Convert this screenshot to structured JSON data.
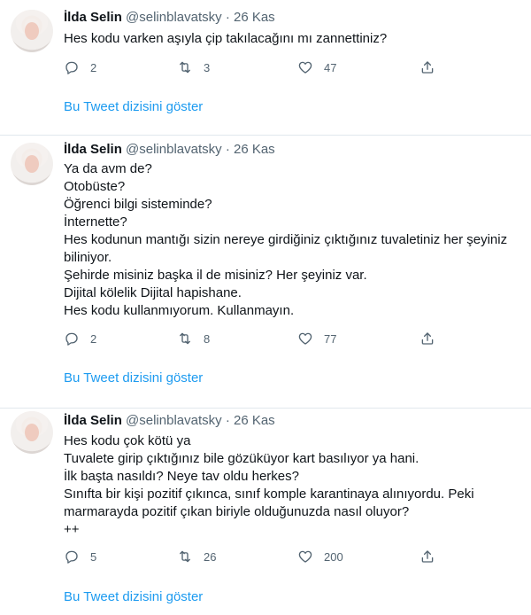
{
  "tweets": [
    {
      "name": "İlda Selin",
      "handle": "@selinblavatsky",
      "dot": "·",
      "date": "26 Kas",
      "lines": [
        "Hes kodu varken aşıyla çip takılacağını mı zannettiniz?"
      ],
      "replies": "2",
      "retweets": "3",
      "likes": "47",
      "show_thread": "Bu Tweet dizisini göster"
    },
    {
      "name": "İlda Selin",
      "handle": "@selinblavatsky",
      "dot": "·",
      "date": "26 Kas",
      "lines": [
        "Ya da avm de?",
        "Otobüste?",
        "Öğrenci bilgi sisteminde?",
        "İnternette?",
        "Hes kodunun mantığı sizin nereye girdiğiniz çıktığınız tuvaletiniz her şeyiniz",
        "biliniyor.",
        "Şehirde misiniz başka il de misiniz? Her şeyiniz var.",
        "Dijital kölelik Dijital hapishane.",
        "Hes kodu kullanmıyorum. Kullanmayın."
      ],
      "replies": "2",
      "retweets": "8",
      "likes": "77",
      "show_thread": "Bu Tweet dizisini göster"
    },
    {
      "name": "İlda Selin",
      "handle": "@selinblavatsky",
      "dot": "·",
      "date": "26 Kas",
      "lines": [
        "Hes kodu çok kötü ya",
        "Tuvalete girip çıktığınız bile gözüküyor kart basılıyor ya hani.",
        "İlk başta nasıldı? Neye tav oldu herkes?",
        "Sınıfta bir kişi pozitif çıkınca, sınıf komple karantinaya alınıyordu. Peki",
        "marmarayda pozitif çıkan biriyle olduğunuzda nasıl oluyor?",
        "++"
      ],
      "replies": "5",
      "retweets": "26",
      "likes": "200",
      "show_thread": "Bu Tweet dizisini göster"
    }
  ],
  "icons": {
    "reply": "reply-icon",
    "retweet": "retweet-icon",
    "like": "like-icon",
    "share": "share-icon",
    "avatar": "avatar"
  },
  "colors": {
    "link": "#1d9bf0",
    "secondary_text": "#536471",
    "divider": "#e1e8ed"
  }
}
